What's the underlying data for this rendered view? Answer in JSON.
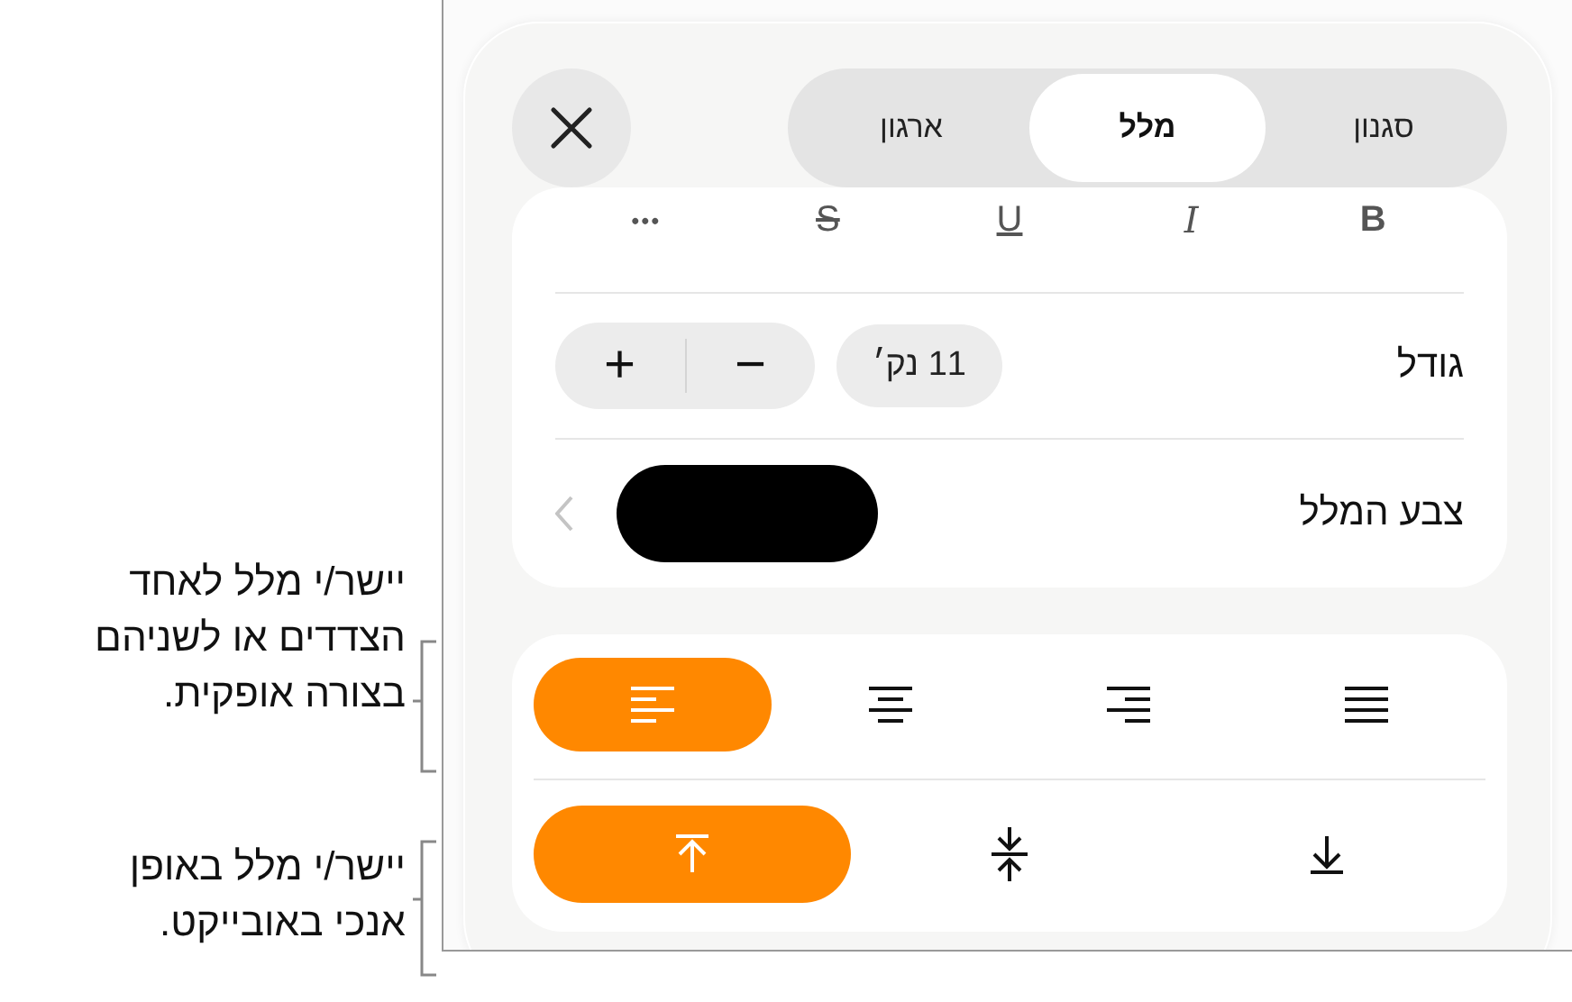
{
  "callouts": [
    {
      "lines": [
        "יישר/י מלל לאחד",
        "הצדדים או לשניהם",
        "בצורה אופקית."
      ]
    },
    {
      "lines": [
        "יישר/י מלל באופן",
        "אנכי באובייקט."
      ]
    }
  ],
  "tabs": [
    {
      "label": "סגנון",
      "selected": false
    },
    {
      "label": "מלל",
      "selected": true
    },
    {
      "label": "ארגון",
      "selected": false
    }
  ],
  "style_buttons": [
    {
      "label": "B",
      "kind": "bold"
    },
    {
      "label": "I",
      "kind": "italic"
    },
    {
      "label": "U",
      "kind": "underline"
    },
    {
      "label": "S",
      "kind": "strikethrough"
    },
    {
      "label": "•••",
      "kind": "more"
    }
  ],
  "size": {
    "label": "גודל",
    "value": "11 נק׳",
    "decrease": "−",
    "increase": "+"
  },
  "text_color": {
    "label": "צבע המלל",
    "color": "#000000"
  },
  "horizontal_alignment": [
    {
      "kind": "left",
      "selected": true
    },
    {
      "kind": "center",
      "selected": false
    },
    {
      "kind": "right",
      "selected": false
    },
    {
      "kind": "justify",
      "selected": false
    }
  ],
  "vertical_alignment": [
    {
      "kind": "top",
      "selected": true
    },
    {
      "kind": "middle",
      "selected": false
    },
    {
      "kind": "bottom",
      "selected": false
    }
  ]
}
